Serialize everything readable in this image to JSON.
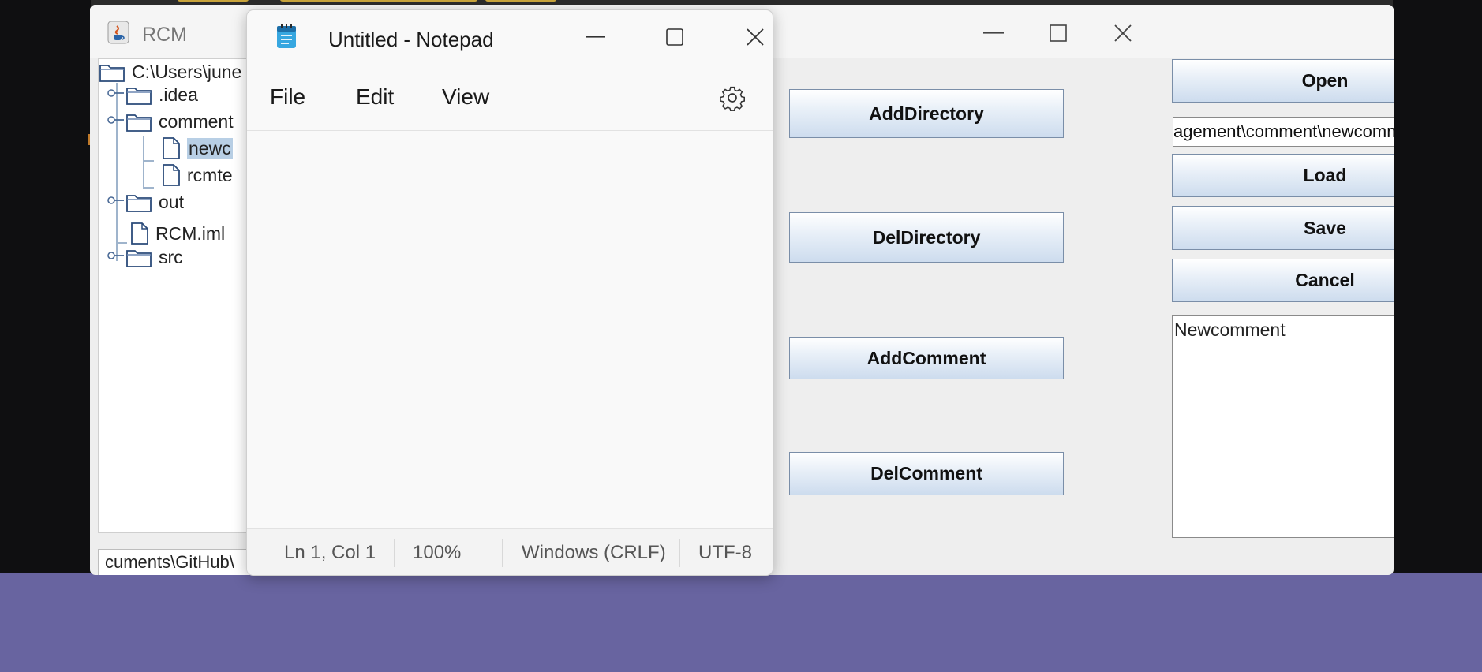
{
  "rcm_window": {
    "title": "RCM",
    "tree": {
      "root": "C:\\Users\\june",
      "items": [
        {
          "label": ".idea",
          "type": "folder"
        },
        {
          "label": "comment",
          "type": "folder"
        },
        {
          "label": "newc",
          "type": "file",
          "selected": true
        },
        {
          "label": "rcmte",
          "type": "file"
        },
        {
          "label": "out",
          "type": "folder"
        },
        {
          "label": "RCM.iml",
          "type": "file"
        },
        {
          "label": "src",
          "type": "folder"
        }
      ]
    },
    "status_path": "cuments\\GitHub\\",
    "buttons": {
      "add_directory": "AddDirectory",
      "del_directory": "DelDirectory",
      "add_comment": "AddComment",
      "del_comment": "DelComment",
      "open": "Open",
      "load": "Load",
      "save": "Save",
      "cancel": "Cancel"
    },
    "path_field": "agement\\comment\\newcomment.t",
    "comment_text": "Newcomment"
  },
  "notepad": {
    "title": "Untitled - Notepad",
    "menu": [
      "File",
      "Edit",
      "View"
    ],
    "status": {
      "position": "Ln 1, Col 1",
      "zoom": "100%",
      "line_ending": "Windows (CRLF)",
      "encoding": "UTF-8"
    }
  },
  "colors": {
    "desktop": "#6864a0",
    "selection": "#b8cfe5",
    "button_border": "#7a8ea8"
  }
}
